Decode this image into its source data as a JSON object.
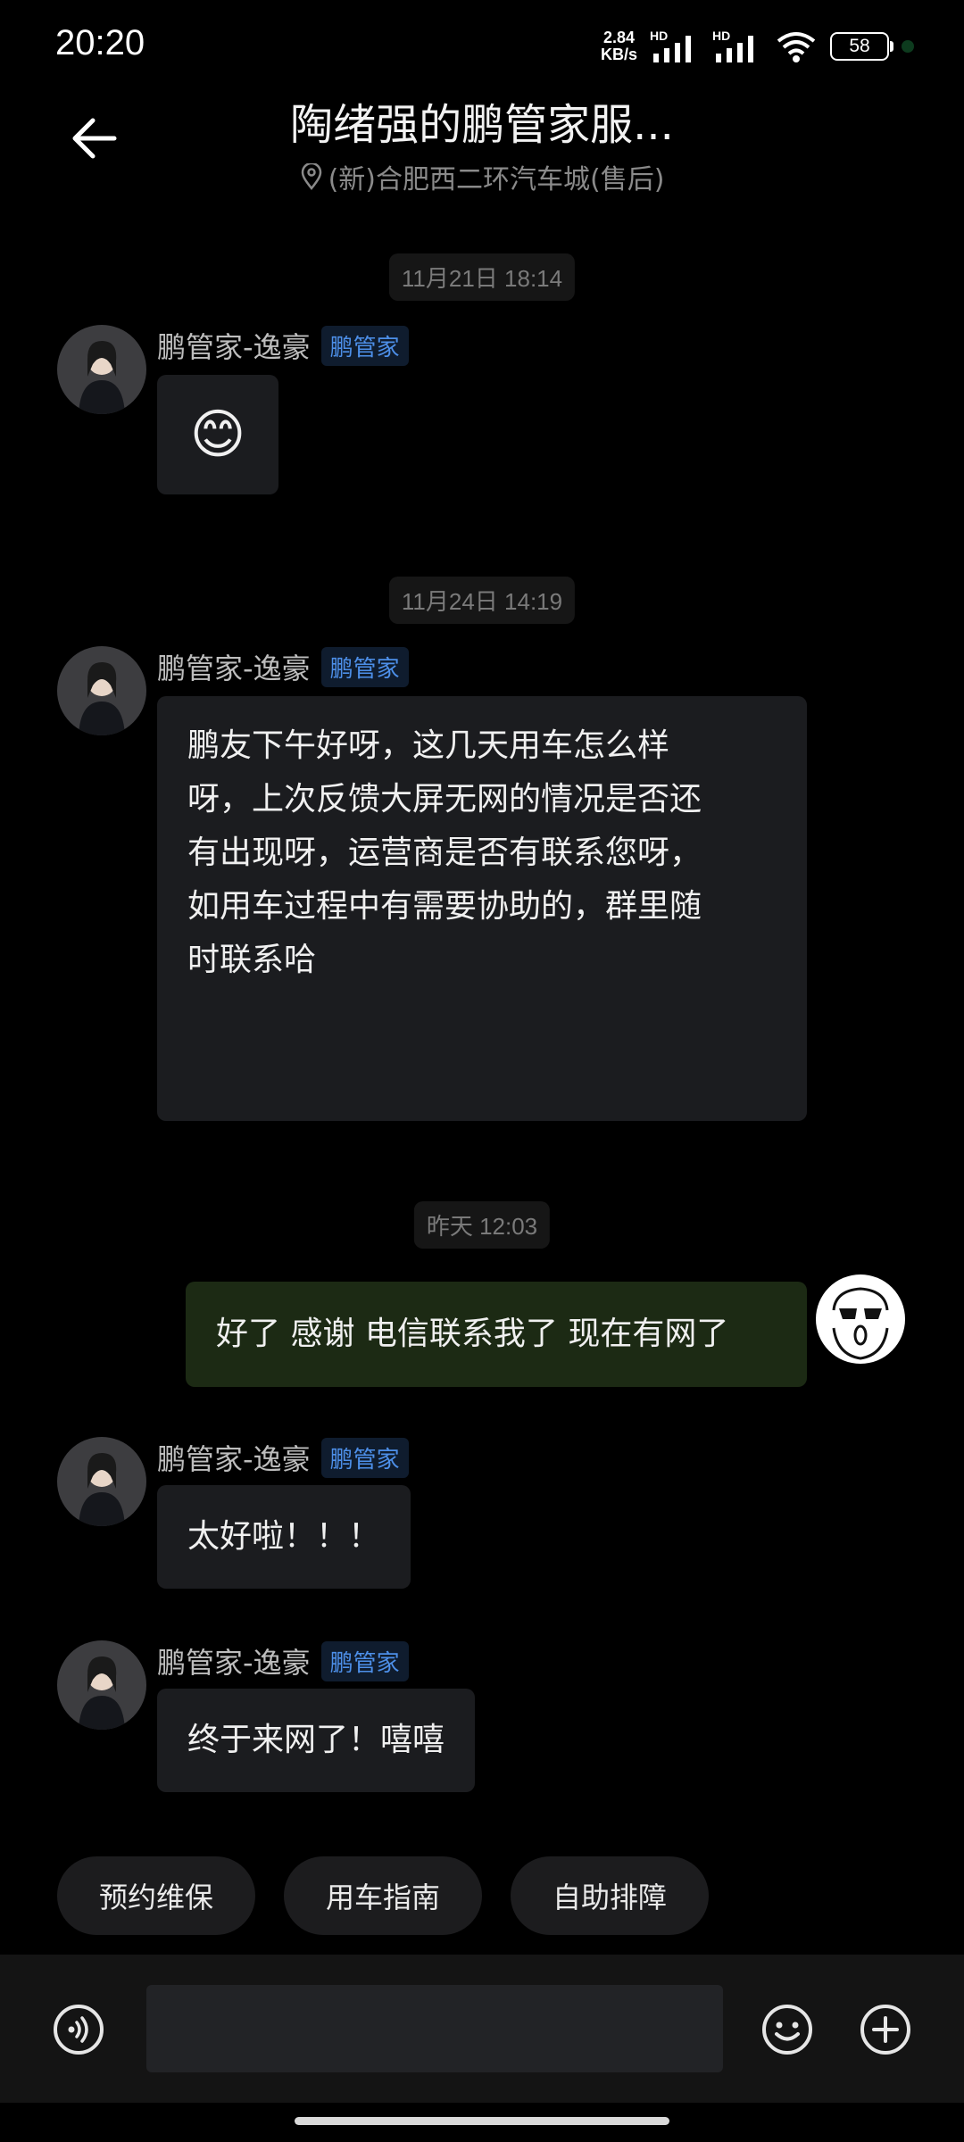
{
  "status_bar": {
    "time": "20:20",
    "speed_value": "2.84",
    "speed_unit": "KB/s",
    "network1": "HD",
    "network2": "HD",
    "battery": "58"
  },
  "header": {
    "title": "陶绪强的鹏管家服...",
    "location": "(新)合肥西二环汽车城(售后)"
  },
  "messages": [
    {
      "timestamp": "11月21日 18:14",
      "sender": "鹏管家-逸豪",
      "tag": "鹏管家",
      "text": "😊"
    },
    {
      "timestamp": "11月24日 14:19",
      "sender": "鹏管家-逸豪",
      "tag": "鹏管家",
      "lines": [
        "鹏友下午好呀，这几天用车怎么样",
        "呀，上次反馈大屏无网的情况是否还",
        "有出现呀，运营商是否有联系您呀，",
        "如用车过程中有需要协助的，群里随",
        "时联系哈"
      ]
    },
    {
      "timestamp": "昨天 12:03",
      "sender": "self",
      "text": "好了 感谢 电信联系我了  现在有网了"
    },
    {
      "sender": "鹏管家-逸豪",
      "tag": "鹏管家",
      "text": "太好啦！！！"
    },
    {
      "sender": "鹏管家-逸豪",
      "tag": "鹏管家",
      "text": "终于来网了！嘻嘻"
    }
  ],
  "quick_actions": [
    "预约维保",
    "用车指南",
    "自助排障"
  ],
  "colors": {
    "background": "#000000",
    "bubble": "#1b1c1f",
    "self_bubble": "#1c2a14",
    "tag": "#4d8fe8"
  },
  "icons": [
    "back-arrow-icon",
    "location-pin-icon",
    "voice-icon",
    "emoji-icon",
    "plus-icon"
  ]
}
